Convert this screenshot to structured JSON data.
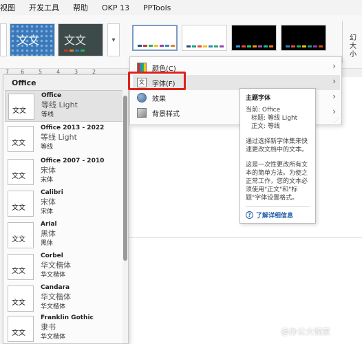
{
  "menubar": {
    "items": [
      "视图",
      "开发工具",
      "帮助",
      "OKP 13",
      "PPTools"
    ]
  },
  "ribbon": {
    "theme_thumb_text_1": "文文",
    "theme_thumb_text_2": "文文",
    "scroll_glyph": "▾",
    "right_label_1": "幻",
    "right_label_2": "大小"
  },
  "ruler": {
    "marks": [
      "7",
      "6",
      "5",
      "4",
      "3",
      "2"
    ]
  },
  "font_panel": {
    "header": "Office",
    "items": [
      {
        "name": "Office",
        "heading": "等线 Light",
        "body": "等线",
        "preview": "文文"
      },
      {
        "name": "Office 2013 - 2022",
        "heading": "等线 Light",
        "body": "等线",
        "preview": "文文"
      },
      {
        "name": "Office 2007 - 2010",
        "heading": "宋体",
        "body": "宋体",
        "preview": "文文"
      },
      {
        "name": "Calibri",
        "heading": "宋体",
        "body": "宋体",
        "preview": "文文"
      },
      {
        "name": "Arial",
        "heading": "黑体",
        "body": "黑体",
        "preview": "文文"
      },
      {
        "name": "Corbel",
        "heading": "华文楷体",
        "body": "华文楷体",
        "preview": "文文"
      },
      {
        "name": "Candara",
        "heading": "华文楷体",
        "body": "华文楷体",
        "preview": "文文"
      },
      {
        "name": "Franklin Gothic",
        "heading": "隶书",
        "body": "华文楷体",
        "preview": "文文"
      }
    ]
  },
  "context_menu": {
    "colors": "颜色(C)",
    "fonts": "字体(F)",
    "fonts_icon_text": "文",
    "effects": "效果",
    "background": "背景样式",
    "arrow": "›"
  },
  "tooltip": {
    "title": "主题字体",
    "current": "当前: Office",
    "heading": "标题: 等线 Light",
    "body": "正文: 等线",
    "para1": "通过选择新字体集来快速更改文档中的文本。",
    "para2": "这是一次性更改所有文本的简单方法。为使之正常工作，您的文本必须使用\"正文\"和\"标题\"字体设置格式。",
    "link": "了解详细信息",
    "help_glyph": "?"
  },
  "watermark": "@办公大骑家",
  "colors": {
    "highlight": "#e0201a",
    "link": "#2361a8"
  }
}
